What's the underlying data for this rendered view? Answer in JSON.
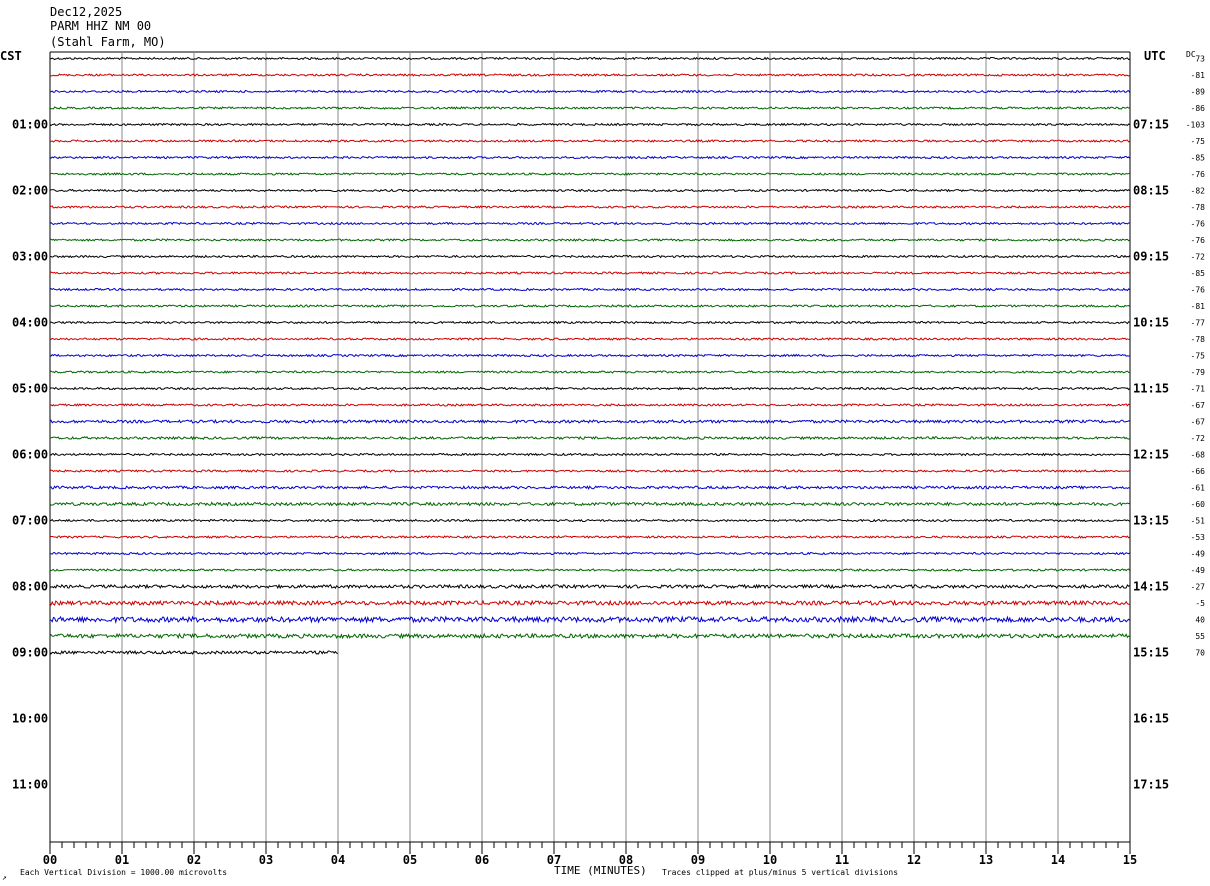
{
  "header": {
    "date": "Dec12,2025",
    "station": "PARM HHZ NM 00",
    "location": "(Stahl Farm, MO)"
  },
  "left_zone_label": "CST",
  "right_zone_label": "UTC",
  "dc_label": "DC",
  "footer": {
    "xlabel": "TIME (MINUTES)",
    "scale_note": "Each Vertical Division = 1000.00 microvolts",
    "clip_note": "Traces clipped at plus/minus 5 vertical divisions",
    "corner_mark": "↗"
  },
  "colors": {
    "trace_cycle": [
      "#000000",
      "#cc0000",
      "#0000cc",
      "#006600"
    ],
    "grid": "#888888",
    "text": "#000000"
  },
  "chart_data": {
    "type": "helicorder",
    "minutes_per_line": 15,
    "total_rows": 48,
    "x_ticks": [
      "00",
      "01",
      "02",
      "03",
      "04",
      "05",
      "06",
      "07",
      "08",
      "09",
      "10",
      "11",
      "12",
      "13",
      "14",
      "15"
    ],
    "xlim": [
      0,
      15
    ],
    "hour_labels_left": [
      "01:00",
      "02:00",
      "03:00",
      "04:00",
      "05:00",
      "06:00",
      "07:00",
      "08:00",
      "09:00",
      "10:00",
      "11:00"
    ],
    "hour_labels_right": [
      "07:15",
      "08:15",
      "09:15",
      "10:15",
      "11:15",
      "12:15",
      "13:15",
      "14:15",
      "15:15",
      "16:15",
      "17:15"
    ],
    "traces": [
      {
        "dc": "73",
        "end_minute": 15,
        "noise": 1.0
      },
      {
        "dc": "-81",
        "end_minute": 15,
        "noise": 1.0
      },
      {
        "dc": "-89",
        "end_minute": 15,
        "noise": 1.0
      },
      {
        "dc": "-86",
        "end_minute": 15,
        "noise": 1.0
      },
      {
        "dc": "-103",
        "end_minute": 15,
        "noise": 1.0
      },
      {
        "dc": "-75",
        "end_minute": 15,
        "noise": 1.0
      },
      {
        "dc": "-85",
        "end_minute": 15,
        "noise": 1.0
      },
      {
        "dc": "-76",
        "end_minute": 15,
        "noise": 1.0
      },
      {
        "dc": "-82",
        "end_minute": 15,
        "noise": 1.0
      },
      {
        "dc": "-78",
        "end_minute": 15,
        "noise": 1.0
      },
      {
        "dc": "-76",
        "end_minute": 15,
        "noise": 1.0
      },
      {
        "dc": "-76",
        "end_minute": 15,
        "noise": 1.0
      },
      {
        "dc": "-72",
        "end_minute": 15,
        "noise": 1.0
      },
      {
        "dc": "-85",
        "end_minute": 15,
        "noise": 1.0
      },
      {
        "dc": "-76",
        "end_minute": 15,
        "noise": 1.0
      },
      {
        "dc": "-81",
        "end_minute": 15,
        "noise": 1.0
      },
      {
        "dc": "-77",
        "end_minute": 15,
        "noise": 1.0
      },
      {
        "dc": "-78",
        "end_minute": 15,
        "noise": 1.0
      },
      {
        "dc": "-75",
        "end_minute": 15,
        "noise": 1.0
      },
      {
        "dc": "-79",
        "end_minute": 15,
        "noise": 1.0
      },
      {
        "dc": "-71",
        "end_minute": 15,
        "noise": 1.0
      },
      {
        "dc": "-67",
        "end_minute": 15,
        "noise": 1.0
      },
      {
        "dc": "-67",
        "end_minute": 15,
        "noise": 1.4
      },
      {
        "dc": "-72",
        "end_minute": 15,
        "noise": 1.2
      },
      {
        "dc": "-68",
        "end_minute": 15,
        "noise": 1.0
      },
      {
        "dc": "-66",
        "end_minute": 15,
        "noise": 1.0
      },
      {
        "dc": "-61",
        "end_minute": 15,
        "noise": 1.3
      },
      {
        "dc": "-60",
        "end_minute": 15,
        "noise": 1.5
      },
      {
        "dc": "-51",
        "end_minute": 15,
        "noise": 1.0
      },
      {
        "dc": "-53",
        "end_minute": 15,
        "noise": 1.0
      },
      {
        "dc": "-49",
        "end_minute": 15,
        "noise": 1.0
      },
      {
        "dc": "-49",
        "end_minute": 15,
        "noise": 1.0
      },
      {
        "dc": "-27",
        "end_minute": 15,
        "noise": 1.6
      },
      {
        "dc": "-5",
        "end_minute": 15,
        "noise": 2.0
      },
      {
        "dc": "40",
        "end_minute": 15,
        "noise": 2.6
      },
      {
        "dc": "55",
        "end_minute": 15,
        "noise": 2.0
      },
      {
        "dc": "70",
        "end_minute": 4,
        "noise": 1.5
      }
    ]
  }
}
